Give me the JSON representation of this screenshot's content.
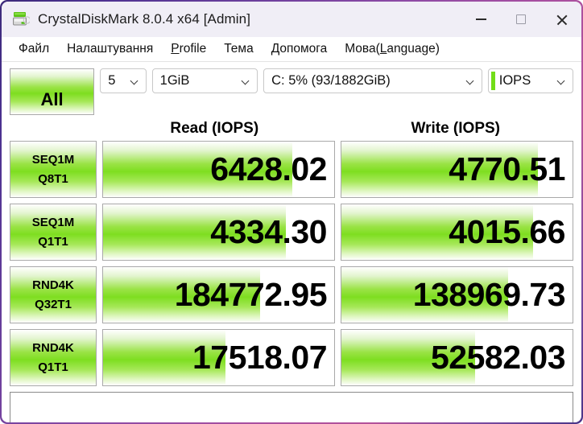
{
  "window": {
    "title": "CrystalDiskMark 8.0.4 x64 [Admin]",
    "icon": "disk-drive-icon",
    "minimize_label": "—",
    "maximize_label": "□",
    "close_label": "✕",
    "accent_color": "#7ede20",
    "border_color": "#8d4aa5"
  },
  "menu": {
    "items": [
      {
        "label": "Файл"
      },
      {
        "label": "Налаштування"
      },
      {
        "label": "Profile",
        "mnemonic": "P"
      },
      {
        "label": "Тема"
      },
      {
        "label": "Допомога"
      },
      {
        "label": "Мова(Language)",
        "mnemonic": "L"
      }
    ]
  },
  "controls": {
    "all_button": "All",
    "test_count": "5",
    "test_size": "1GiB",
    "drive": "C: 5% (93/1882GiB)",
    "units": "IOPS"
  },
  "columns": {
    "read": "Read (IOPS)",
    "write": "Write (IOPS)"
  },
  "chart_data": {
    "type": "bar",
    "title": "CrystalDiskMark 8.0.4 benchmark results",
    "units": "IOPS",
    "categories": [
      "SEQ1M Q8T1",
      "SEQ1M Q1T1",
      "RND4K Q32T1",
      "RND4K Q1T1"
    ],
    "series": [
      {
        "name": "Read (IOPS)",
        "values": [
          6428.02,
          4334.3,
          184772.95,
          17518.07
        ]
      },
      {
        "name": "Write (IOPS)",
        "values": [
          4770.51,
          4015.66,
          138969.73,
          52582.03
        ]
      }
    ],
    "legend_position": "top"
  },
  "rows": [
    {
      "label_line1": "SEQ1M",
      "label_line2": "Q8T1",
      "read": {
        "value": "6428.02",
        "fill": 82
      },
      "write": {
        "value": "4770.51",
        "fill": 85
      }
    },
    {
      "label_line1": "SEQ1M",
      "label_line2": "Q1T1",
      "read": {
        "value": "4334.30",
        "fill": 79
      },
      "write": {
        "value": "4015.66",
        "fill": 83
      }
    },
    {
      "label_line1": "RND4K",
      "label_line2": "Q32T1",
      "read": {
        "value": "184772.95",
        "fill": 68
      },
      "write": {
        "value": "138969.73",
        "fill": 72
      }
    },
    {
      "label_line1": "RND4K",
      "label_line2": "Q1T1",
      "read": {
        "value": "17518.07",
        "fill": 53
      },
      "write": {
        "value": "52582.03",
        "fill": 58
      }
    }
  ],
  "comment": {
    "value": "",
    "placeholder": ""
  }
}
